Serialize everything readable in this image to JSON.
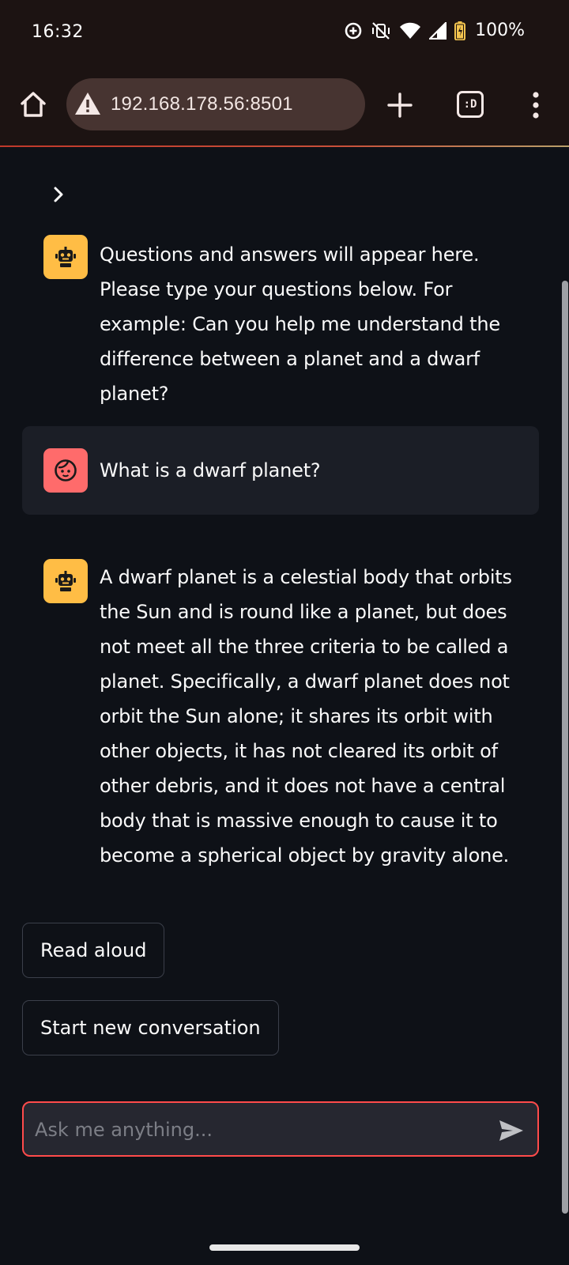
{
  "status_bar": {
    "time": "16:32",
    "icons": [
      "data-saver-icon",
      "vibrate-off-icon",
      "wifi-icon",
      "signal-icon",
      "battery-icon"
    ],
    "battery": "100%"
  },
  "browser": {
    "url": "192.168.178.56:8501",
    "tabs_label": ":D",
    "colors": {
      "toolbar_bg": "#1c1312",
      "url_bar_bg": "#473431"
    }
  },
  "chat": {
    "messages": [
      {
        "role": "assistant",
        "text": "Questions and answers will appear here. Please type your questions below. For example: Can you help me understand the difference between a planet and a dwarf planet?"
      },
      {
        "role": "user",
        "text": "What is a dwarf planet?"
      },
      {
        "role": "assistant",
        "text": "A dwarf planet is a celestial body that orbits the Sun and is round like a planet, but does not meet all the three criteria to be called a planet. Specifically, a dwarf planet does not orbit the Sun alone; it shares its orbit with other objects, it has not cleared its orbit of other debris, and it does not have a central body that is massive enough to cause it to become a spherical object by gravity alone."
      }
    ],
    "read_aloud_label": "Read aloud",
    "new_conversation_label": "Start new conversation",
    "input": {
      "placeholder": "Ask me anything...",
      "value": ""
    },
    "colors": {
      "background": "#0e1117",
      "bot_avatar": "#ffbd45",
      "user_avatar": "#ff6b6b",
      "input_border": "#ff4b4b"
    }
  }
}
